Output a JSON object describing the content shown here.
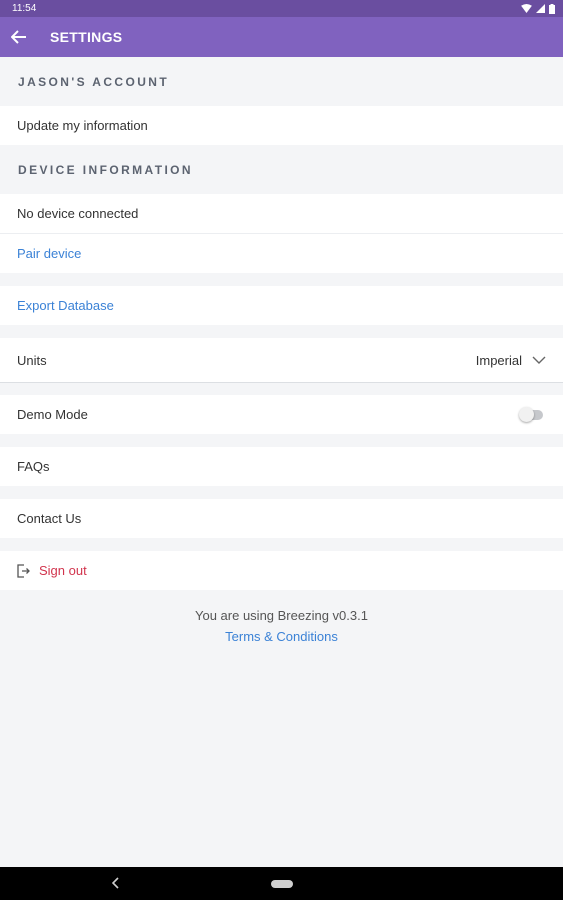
{
  "status_bar": {
    "time": "11:54"
  },
  "header": {
    "title": "SETTINGS"
  },
  "account_section": {
    "title": "JASON'S ACCOUNT",
    "update_info": "Update my information"
  },
  "device_section": {
    "title": "DEVICE INFORMATION",
    "status": "No device connected",
    "pair": "Pair device"
  },
  "export": {
    "label": "Export Database"
  },
  "units": {
    "label": "Units",
    "value": "Imperial"
  },
  "demo": {
    "label": "Demo Mode",
    "enabled": false
  },
  "faqs": {
    "label": "FAQs"
  },
  "contact": {
    "label": "Contact Us"
  },
  "signout": {
    "label": "Sign out"
  },
  "footer": {
    "version_text": "You are using Breezing v0.3.1",
    "terms": "Terms & Conditions"
  },
  "colors": {
    "app_bar": "#8062bf",
    "link": "#3b82d6",
    "danger": "#d1344d"
  }
}
